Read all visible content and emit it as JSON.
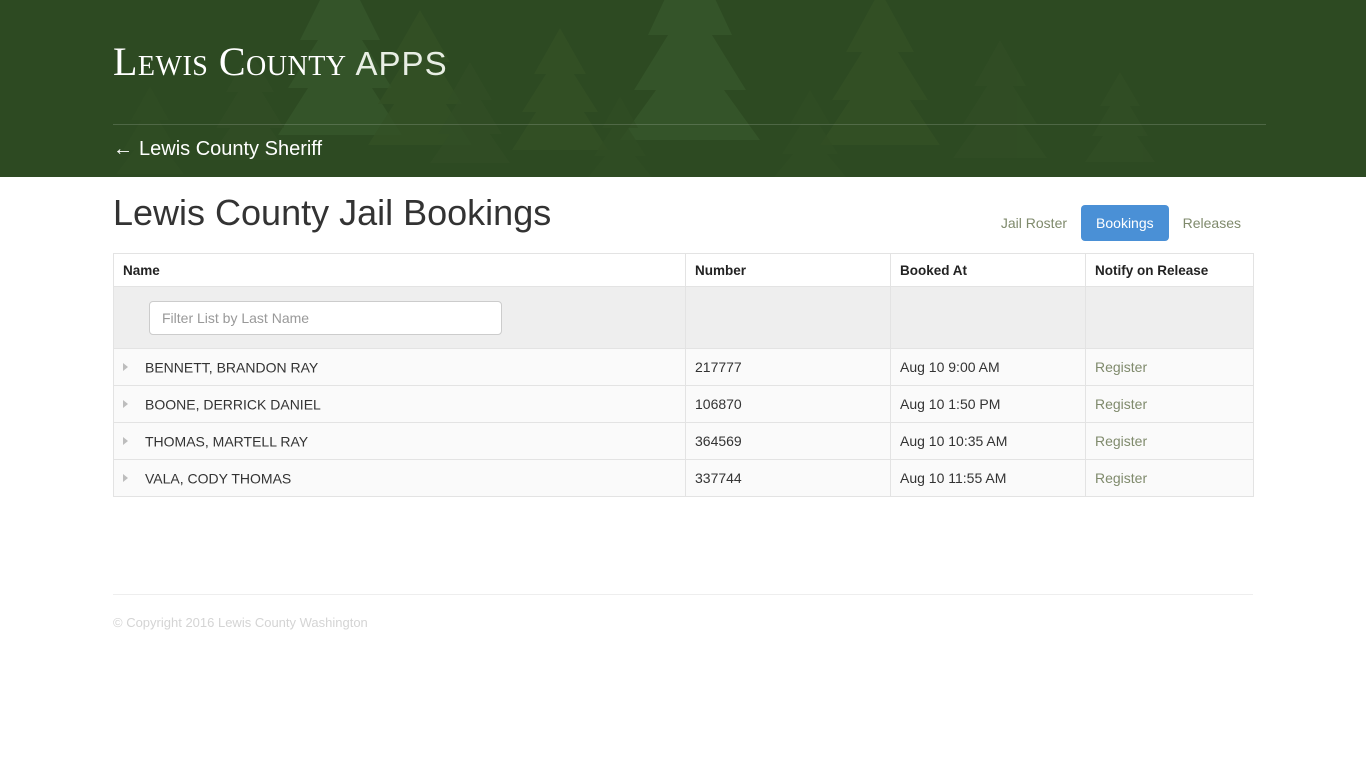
{
  "header": {
    "brand_main": "Lewis County",
    "brand_sub": "APPS",
    "back_link": {
      "arrow": "←",
      "label": "Lewis County Sheriff"
    },
    "background_color": "#2d4a22",
    "background_motif": "evergreen-trees"
  },
  "main": {
    "page_title": "Lewis County Jail Bookings",
    "nav": [
      {
        "label": "Jail Roster",
        "active": false
      },
      {
        "label": "Bookings",
        "active": true
      },
      {
        "label": "Releases",
        "active": false
      }
    ],
    "accent_color": "#4a90d6",
    "link_color": "#7f8a6c",
    "table": {
      "columns": [
        "Name",
        "Number",
        "Booked At",
        "Notify on Release"
      ],
      "filter": {
        "placeholder": "Filter List by Last Name",
        "value": ""
      },
      "rows": [
        {
          "name": "BENNETT, BRANDON RAY",
          "number": "217777",
          "booked_at": "Aug 10 9:00 AM",
          "notify": "Register"
        },
        {
          "name": "BOONE, DERRICK DANIEL",
          "number": "106870",
          "booked_at": "Aug 10 1:50 PM",
          "notify": "Register"
        },
        {
          "name": "THOMAS, MARTELL RAY",
          "number": "364569",
          "booked_at": "Aug 10 10:35 AM",
          "notify": "Register"
        },
        {
          "name": "VALA, CODY THOMAS",
          "number": "337744",
          "booked_at": "Aug 10 11:55 AM",
          "notify": "Register"
        }
      ]
    }
  },
  "footer": {
    "copyright": "© Copyright 2016 Lewis County Washington"
  }
}
